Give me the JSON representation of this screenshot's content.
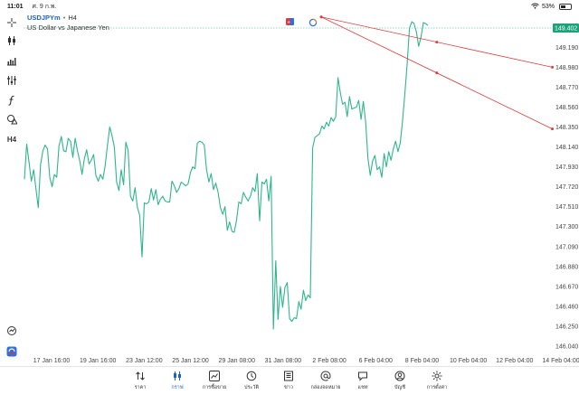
{
  "status_bar": {
    "time": "11:01",
    "date": "ศ. 9 ก.พ.",
    "battery": "53%",
    "battery_level": 0.53
  },
  "symbol": {
    "name": "USDJPYm",
    "separator": "•",
    "timeframe": "H4",
    "description": "US Dollar vs Japanese Yen"
  },
  "toolbar": {
    "timeframe_label": "H4",
    "icons": [
      "crosshair-icon",
      "candlestick-icon",
      "indicators-icon",
      "settings-sliders-icon",
      "function-icon",
      "shapes-icon",
      "timeframe-icon",
      "scroll-to-now-icon",
      "trade-icon"
    ]
  },
  "colors": {
    "line": "#2fb58c",
    "trend": "#e03c3c",
    "price_tag": "#1aa37a",
    "active_nav": "#1e62d0"
  },
  "chart_data": {
    "type": "line",
    "price_axis": [
      "149.402",
      "149.190",
      "148.980",
      "148.770",
      "148.560",
      "148.350",
      "148.140",
      "147.930",
      "147.720",
      "147.510",
      "147.300",
      "147.090",
      "146.880",
      "146.670",
      "146.460",
      "146.250",
      "146.040"
    ],
    "current_price": "149.402",
    "time_axis": [
      "17 Jan 16:00",
      "19 Jan 16:00",
      "23 Jan 12:00",
      "25 Jan 12:00",
      "29 Jan 08:00",
      "31 Jan 08:00",
      "2 Feb 08:00",
      "6 Feb 04:00",
      "8 Feb 04:00",
      "10 Feb 04:00",
      "12 Feb 04:00",
      "14 Feb 04:00"
    ],
    "ylim": [
      146.04,
      149.46
    ],
    "series": [
      {
        "values": [
          147.8,
          148.17,
          147.98,
          147.78,
          147.9,
          147.7,
          147.5,
          147.95,
          148.1,
          148.16,
          148.12,
          147.82,
          147.72,
          147.85,
          147.82,
          148.15,
          148.25,
          148.1,
          148.09,
          148.23,
          148.2,
          148.03,
          148.23,
          148.1,
          147.99,
          147.85,
          148.02,
          148.11,
          147.96,
          148.0,
          148.06,
          147.84,
          147.78,
          147.85,
          147.8,
          147.94,
          148.15,
          148.35,
          148.26,
          148.14,
          147.77,
          147.68,
          147.9,
          147.74,
          148.19,
          148.1,
          147.62,
          147.57,
          147.71,
          147.5,
          147.42,
          146.98,
          147.55,
          147.54,
          147.56,
          147.7,
          147.58,
          147.69,
          147.53,
          147.59,
          147.62,
          147.57,
          147.56,
          147.56,
          147.78,
          147.73,
          147.66,
          147.7,
          147.77,
          147.75,
          147.73,
          147.75,
          147.87,
          147.93,
          147.91,
          148.18,
          148.2,
          148.19,
          148.16,
          147.9,
          147.77,
          147.86,
          147.69,
          147.76,
          147.66,
          147.5,
          147.43,
          147.51,
          147.26,
          147.35,
          147.25,
          147.24,
          147.37,
          147.56,
          147.54,
          147.66,
          147.61,
          147.57,
          147.62,
          147.71,
          147.67,
          147.86,
          147.36,
          147.77,
          147.75,
          147.8,
          147.57,
          147.83,
          146.22,
          146.94,
          146.32,
          146.67,
          146.45,
          146.66,
          146.71,
          146.33,
          146.3,
          146.34,
          146.33,
          146.51,
          146.43,
          146.63,
          146.52,
          146.58,
          146.55,
          148.13,
          148.24,
          148.26,
          148.28,
          148.36,
          148.33,
          148.4,
          148.36,
          148.45,
          148.41,
          148.46,
          148.87,
          148.71,
          148.59,
          148.61,
          148.46,
          148.67,
          148.54,
          148.55,
          148.56,
          148.63,
          148.43,
          148.62,
          148.4,
          148.02,
          147.84,
          147.99,
          148.05,
          147.9,
          147.93,
          147.82,
          148.07,
          147.93,
          148.09,
          148.0,
          148.12,
          148.2,
          148.09,
          148.18,
          148.42,
          148.7,
          149.02,
          149.39,
          149.46,
          149.44,
          149.35,
          149.2,
          149.3,
          149.45,
          149.44,
          149.42
        ]
      }
    ],
    "annotations": [
      {
        "type": "trendline",
        "from": [
          0.536,
          149.51
        ],
        "to": [
          0.952,
          148.98
        ]
      },
      {
        "type": "trendline",
        "from": [
          0.536,
          149.51
        ],
        "to": [
          0.952,
          148.33
        ]
      }
    ]
  },
  "nav": [
    {
      "label": "ราคา",
      "icon": "sort-arrows-icon"
    },
    {
      "label": "กราฟ",
      "icon": "candlestick-icon",
      "active": true
    },
    {
      "label": "การซื้อขาย",
      "icon": "trade-chart-icon"
    },
    {
      "label": "ประวัติ",
      "icon": "history-icon"
    },
    {
      "label": "ข่าว",
      "icon": "news-icon"
    },
    {
      "label": "กล่องจดหมาย",
      "icon": "at-mail-icon"
    },
    {
      "label": "แชท",
      "icon": "chat-icon"
    },
    {
      "label": "บัญชี",
      "icon": "account-icon"
    },
    {
      "label": "การตั้งค่า",
      "icon": "gear-icon"
    }
  ]
}
